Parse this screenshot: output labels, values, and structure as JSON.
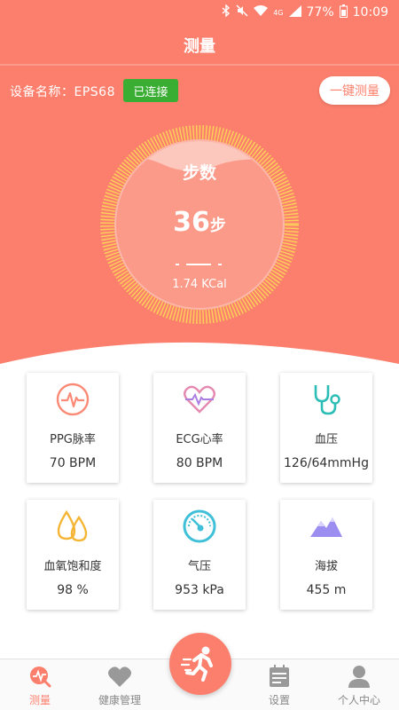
{
  "status_bar": {
    "battery": "77%",
    "time": "10:09",
    "network": "4G"
  },
  "header": {
    "title": "测量"
  },
  "device": {
    "label": "设备名称：EPS68",
    "status": "已连接",
    "measure_button": "一键测量"
  },
  "steps": {
    "label": "步数",
    "value": "36",
    "unit": "步",
    "kcal": "1.74 KCal"
  },
  "cards": [
    {
      "label": "PPG脉率",
      "value": "70 BPM",
      "icon": "pulse-icon"
    },
    {
      "label": "ECG心率",
      "value": "80 BPM",
      "icon": "ecg-heart-icon"
    },
    {
      "label": "血压",
      "value": "126/64mmHg",
      "icon": "stethoscope-icon"
    },
    {
      "label": "血氧饱和度",
      "value": "98 %",
      "icon": "blood-drop-icon"
    },
    {
      "label": "气压",
      "value": "953 kPa",
      "icon": "barometer-gauge-icon"
    },
    {
      "label": "海拔",
      "value": "455 m",
      "icon": "mountain-icon"
    }
  ],
  "tabs": [
    {
      "label": "测量",
      "icon": "measure-icon",
      "active": true
    },
    {
      "label": "健康管理",
      "icon": "heart-icon",
      "active": false
    },
    {
      "label": "设置",
      "icon": "calendar-icon",
      "active": false
    },
    {
      "label": "个人中心",
      "icon": "person-icon",
      "active": false
    }
  ],
  "center_button_icon": "running-man-icon",
  "colors": {
    "accent": "#fb7f6c",
    "connected": "#3aae32",
    "gauge_ticks": "#fcd65a"
  }
}
